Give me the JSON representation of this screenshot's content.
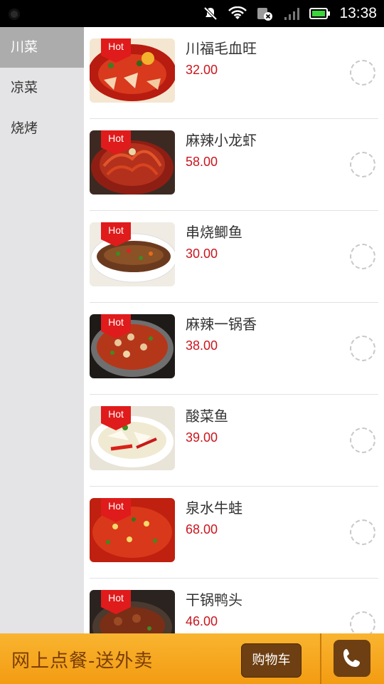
{
  "status_bar": {
    "time": "13:38",
    "icons": [
      "notification-dot-icon",
      "mute-icon",
      "wifi-icon",
      "sim-error-icon",
      "signal-icon",
      "battery-icon"
    ]
  },
  "sidebar": {
    "categories": [
      {
        "label": "川菜",
        "active": true
      },
      {
        "label": "凉菜",
        "active": false
      },
      {
        "label": "烧烤",
        "active": false
      }
    ]
  },
  "menu": {
    "badge": "Hot",
    "items": [
      {
        "name": "川福毛血旺",
        "price": "32.00"
      },
      {
        "name": "麻辣小龙虾",
        "price": "58.00"
      },
      {
        "name": "串烧鲫鱼",
        "price": "30.00"
      },
      {
        "name": "麻辣一锅香",
        "price": "38.00"
      },
      {
        "name": "酸菜鱼",
        "price": "39.00"
      },
      {
        "name": "泉水牛蛙",
        "price": "68.00"
      },
      {
        "name": "干锅鸭头",
        "price": "46.00"
      }
    ]
  },
  "bottom_bar": {
    "title": "网上点餐-送外卖",
    "cart_label": "购物车",
    "phone_icon": "phone-icon"
  },
  "colors": {
    "accent": "#f39c12",
    "price": "#c8161d",
    "button": "#6d3f12",
    "sidebar_active": "#acacac"
  }
}
